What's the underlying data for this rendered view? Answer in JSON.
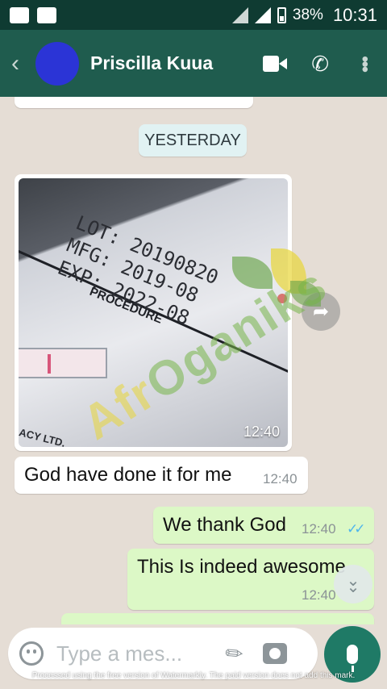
{
  "status_bar": {
    "battery": "38%",
    "time": "10:31",
    "icons": [
      "message-icon",
      "image-icon",
      "signal-icon",
      "battery-icon"
    ]
  },
  "header": {
    "contact_name": "Priscilla Kuua",
    "icons": [
      "back-arrow-icon",
      "video-call-icon",
      "phone-icon",
      "more-vert-icon"
    ]
  },
  "chat": {
    "date_divider": "YESTERDAY",
    "image_message": {
      "time": "12:40",
      "photo_text": {
        "stamp": "LOT: 20190820\nMFG: 2019-08\nEXP: 2022-08",
        "procedure": "PROCEDURE",
        "maker": "ACY LTD."
      }
    },
    "messages": [
      {
        "direction": "in",
        "text": "God have done it for me",
        "time": "12:40"
      },
      {
        "direction": "out",
        "text": "We thank God",
        "time": "12:40",
        "ticks": "✓✓"
      },
      {
        "direction": "out",
        "text": "This Is indeed awesome",
        "time": "12:40"
      }
    ]
  },
  "watermark": {
    "part1": "Afr",
    "part2": "Oganiks"
  },
  "composer": {
    "placeholder": "Type a mes..."
  },
  "footer_note": "Processed using the free version of Watermarkly. The paid version does not add this mark.",
  "colors": {
    "header": "#1f5c4e",
    "status_bar": "#0f3b32",
    "outgoing_bubble": "#dcf8c6",
    "incoming_bubble": "#ffffff",
    "chat_background": "#e5ddd5",
    "mic_button": "#1f7a66",
    "read_ticks": "#4fb6ec"
  }
}
